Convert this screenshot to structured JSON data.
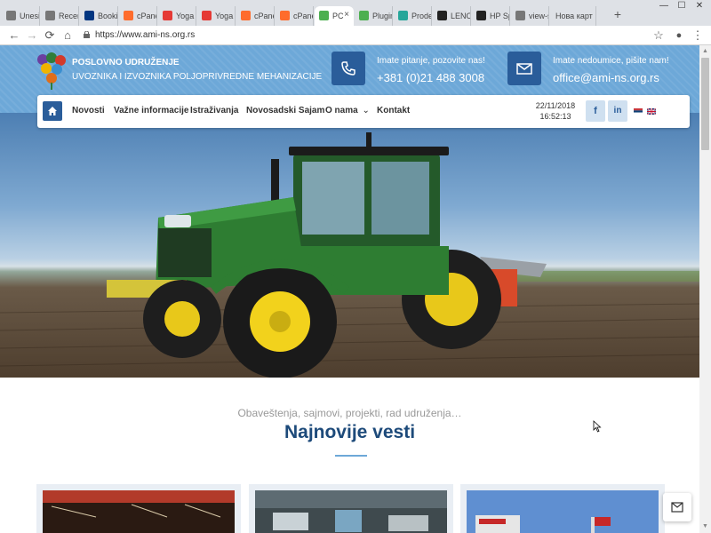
{
  "browser": {
    "tabs": [
      {
        "title": "Unesit",
        "icon": "doc-icon",
        "color": "#777777"
      },
      {
        "title": "Recen",
        "icon": "doc-icon",
        "color": "#777777"
      },
      {
        "title": "Bookir",
        "icon": "booking-icon",
        "color": "#003580"
      },
      {
        "title": "cPane",
        "icon": "cpanel-icon",
        "color": "#ff6c2c"
      },
      {
        "title": "Yoga",
        "icon": "l-icon",
        "color": "#e53935"
      },
      {
        "title": "Yoga",
        "icon": "l-icon",
        "color": "#e53935"
      },
      {
        "title": "cPane",
        "icon": "cpanel-icon",
        "color": "#ff6c2c"
      },
      {
        "title": "cPane",
        "icon": "cpanel-icon",
        "color": "#ff6c2c"
      },
      {
        "title": "PC",
        "icon": "ami-icon",
        "color": "#4caf50",
        "active": true
      },
      {
        "title": "Plugin",
        "icon": "ami-icon",
        "color": "#4caf50"
      },
      {
        "title": "Prode",
        "icon": "prode-icon",
        "color": "#26a69a"
      },
      {
        "title": "LENO",
        "icon": "b-icon",
        "color": "#222222"
      },
      {
        "title": "HP Sp",
        "icon": "b-icon",
        "color": "#222222"
      },
      {
        "title": "view-s",
        "icon": "doc-icon",
        "color": "#777777"
      },
      {
        "title": "Нова карт",
        "icon": "none",
        "color": "#dee1e6"
      }
    ],
    "close_tab_glyph": "×",
    "new_tab_glyph": "+",
    "window_controls": {
      "minimize": "—",
      "maximize": "☐",
      "close": "✕"
    },
    "url": "https://www.ami-ns.org.rs",
    "nav": {
      "back": "←",
      "forward": "→",
      "reload": "⟳",
      "home": "⌂"
    },
    "toolbar_icons": {
      "star": "☆",
      "account": "●",
      "menu": "⋮"
    }
  },
  "header": {
    "org_name": "POSLOVNO UDRUŽENJE",
    "org_subtitle": "UVOZNIKA I IZVOZNIKA POLJOPRIVREDNE MEHANIZACIJE",
    "phone_caption": "Imate pitanje, pozovite nas!",
    "phone_number": "+381 (0)21 488 3008",
    "email_caption": "Imate nedoumice, pišite nam!",
    "email_address": "office@ami-ns.org.rs"
  },
  "nav": {
    "items": [
      "Novosti",
      "Važne informacije",
      "Istraživanja",
      "Novosadski Sajam",
      "O nama",
      "Kontakt"
    ],
    "dropdown_glyph": "⌄",
    "date": "22/11/2018",
    "time": "16:52:13",
    "social": {
      "facebook": "f",
      "linkedin": "in"
    }
  },
  "news": {
    "subtitle": "Obaveštenja, sajmovi, projekti, rad udruženja…",
    "title": "Najnovije vesti"
  },
  "colors": {
    "header_blue": "#6da8d8",
    "dark_blue": "#2a5d9a",
    "title_blue": "#1d4a7a",
    "tractor_green": "#2e7d32",
    "wheel_yellow": "#f2d21c"
  },
  "scrollbar": {
    "up": "▲",
    "down": "▼"
  }
}
